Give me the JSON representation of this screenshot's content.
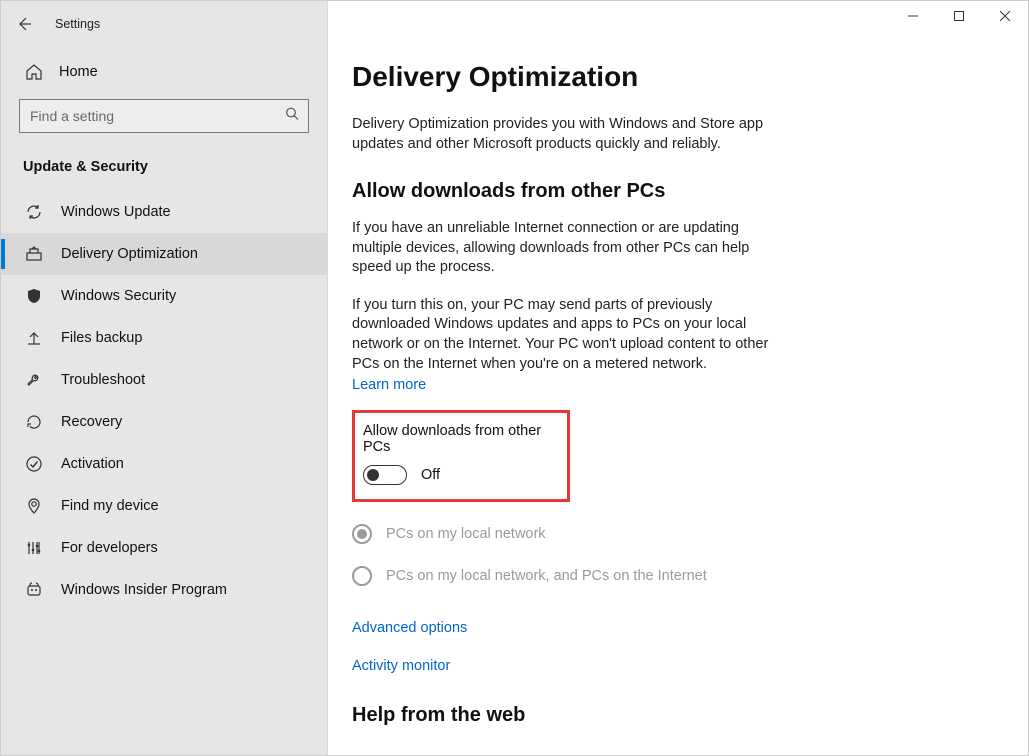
{
  "app_title": "Settings",
  "home_label": "Home",
  "search_placeholder": "Find a setting",
  "section_title": "Update & Security",
  "nav": [
    {
      "label": "Windows Update"
    },
    {
      "label": "Delivery Optimization"
    },
    {
      "label": "Windows Security"
    },
    {
      "label": "Files backup"
    },
    {
      "label": "Troubleshoot"
    },
    {
      "label": "Recovery"
    },
    {
      "label": "Activation"
    },
    {
      "label": "Find my device"
    },
    {
      "label": "For developers"
    },
    {
      "label": "Windows Insider Program"
    }
  ],
  "page": {
    "title": "Delivery Optimization",
    "intro": "Delivery Optimization provides you with Windows and Store app updates and other Microsoft products quickly and reliably.",
    "section_head": "Allow downloads from other PCs",
    "para1": "If you have an unreliable Internet connection or are updating multiple devices, allowing downloads from other PCs can help speed up the process.",
    "para2": "If you turn this on, your PC may send parts of previously downloaded Windows updates and apps to PCs on your local network or on the Internet. Your PC won't upload content to other PCs on the Internet when you're on a metered network.",
    "learn_more": "Learn more",
    "toggle_label": "Allow downloads from other PCs",
    "toggle_state": "Off",
    "radio1": "PCs on my local network",
    "radio2": "PCs on my local network, and PCs on the Internet",
    "advanced_options": "Advanced options",
    "activity_monitor": "Activity monitor",
    "help_head": "Help from the web"
  }
}
